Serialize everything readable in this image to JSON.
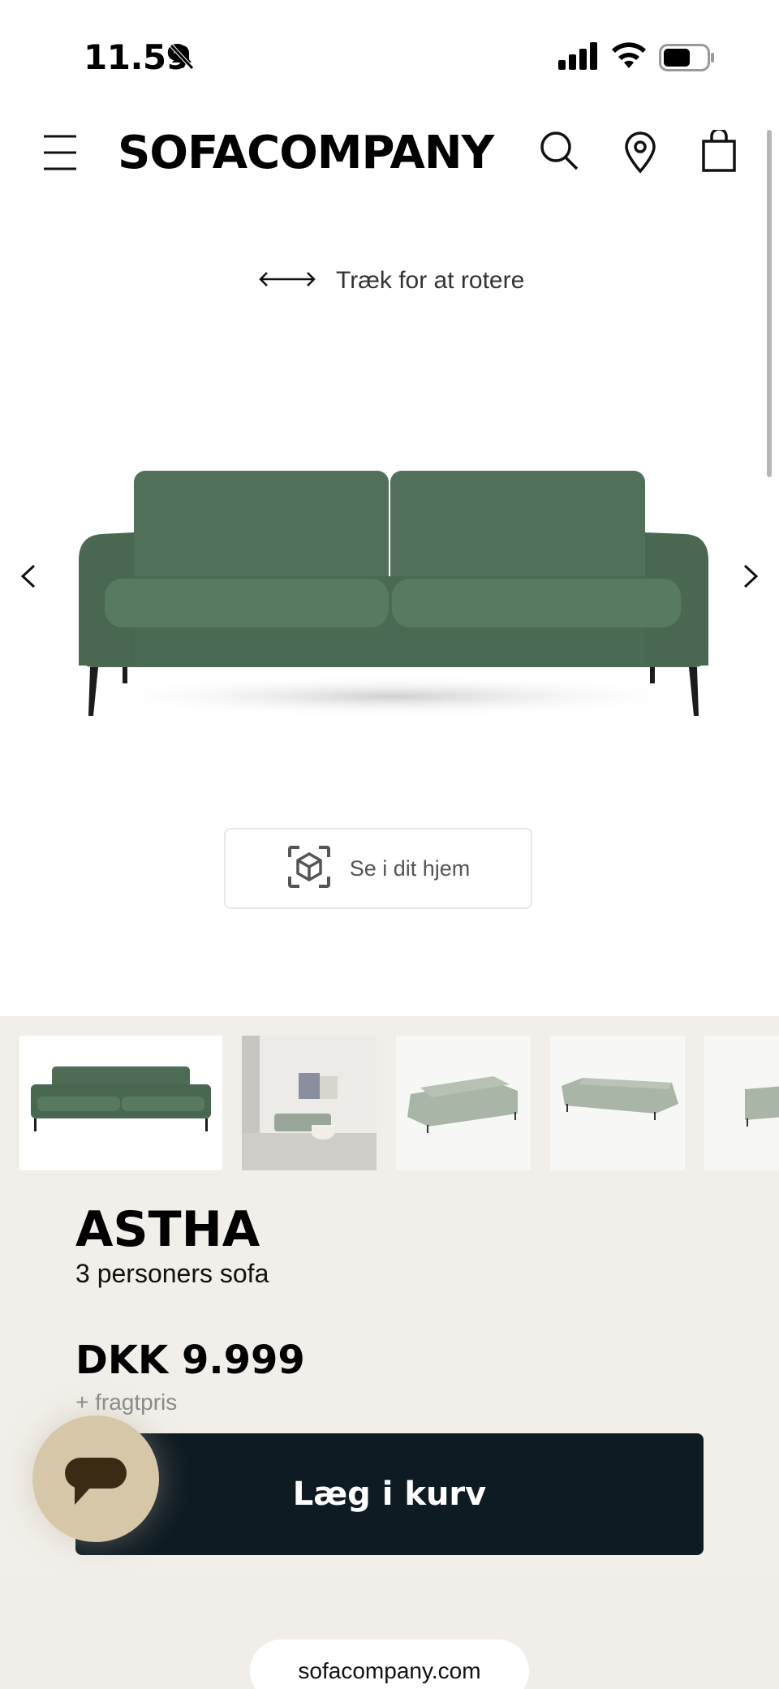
{
  "status": {
    "time": "11.59"
  },
  "header": {
    "brand": "SOFACOMPANY",
    "icons": [
      "menu-icon",
      "search-icon",
      "location-icon",
      "cart-icon"
    ]
  },
  "viewer": {
    "rotate_hint": "Træk for at rotere",
    "ar_button_label": "Se i dit hjem"
  },
  "thumbnails": {
    "count_visible": 5,
    "selected_index": 0
  },
  "product": {
    "name": "ASTHA",
    "subtitle": "3 personers sofa",
    "price": "DKK 9.999",
    "freight_note": "+ fragtpris",
    "add_to_cart_label": "Læg i kurv"
  },
  "browser": {
    "url": "sofacompany.com"
  },
  "colors": {
    "sofa_green": "#4d6a52",
    "cta_dark": "#0f1b23",
    "beige_bg": "#f2efea",
    "chat_bubble": "#d6c7a8"
  }
}
